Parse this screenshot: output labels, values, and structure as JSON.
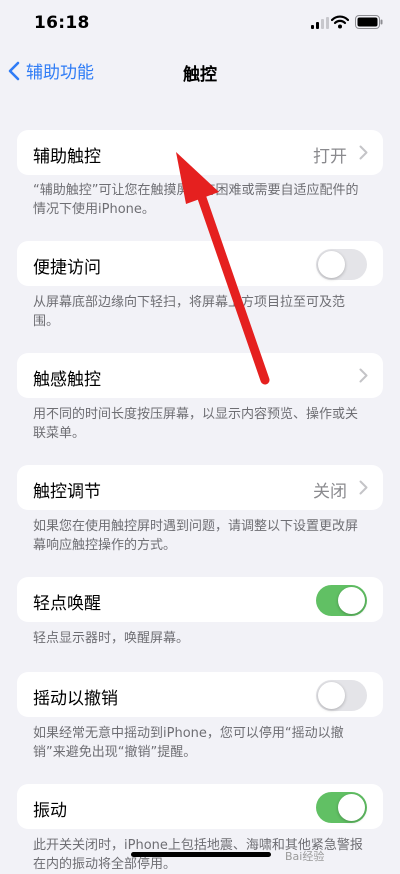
{
  "status_bar": {
    "time": "16:18"
  },
  "nav": {
    "back_label": "辅助功能",
    "title": "触控"
  },
  "items": [
    {
      "label": "辅助触控",
      "value": "打开",
      "control": "chevron",
      "footer": "“辅助触控”可让您在触摸屏幕有困难或需要自适应配件的情况下使用iPhone。"
    },
    {
      "label": "便捷访问",
      "control": "toggle",
      "on": false,
      "footer": "从屏幕底部边缘向下轻扫，将屏幕上方项目拉至可及范围。"
    },
    {
      "label": "触感触控",
      "control": "chevron",
      "footer": "用不同的时间长度按压屏幕，以显示内容预览、操作或关联菜单。"
    },
    {
      "label": "触控调节",
      "value": "关闭",
      "control": "chevron",
      "footer": "如果您在使用触控屏时遇到问题，请调整以下设置更改屏幕响应触控操作的方式。"
    },
    {
      "label": "轻点唤醒",
      "control": "toggle",
      "on": true,
      "footer": "轻点显示器时，唤醒屏幕。"
    },
    {
      "label": "摇动以撤销",
      "control": "toggle",
      "on": false,
      "footer": "如果经常无意中摇动到iPhone，您可以停用“摇动以撤销”来避免出现“撤销”提醒。"
    },
    {
      "label": "振动",
      "control": "toggle",
      "on": true,
      "footer": "此开关关闭时，iPhone上包括地震、海啸和其他紧急警报在内的振动将全部停用。"
    }
  ],
  "watermark": "Bai经验",
  "colors": {
    "accent": "#2f7cf6",
    "toggle_on": "#61c064",
    "annotation_arrow": "#e5201f"
  }
}
